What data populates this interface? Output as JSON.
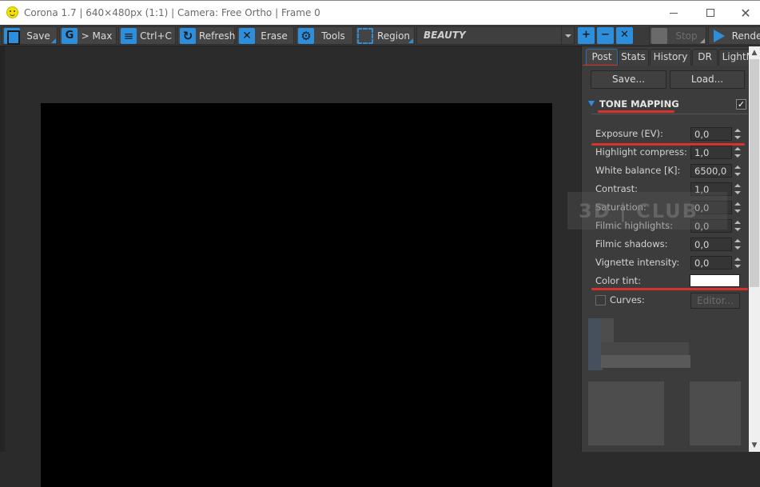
{
  "window": {
    "title": "Corona 1.7 | 640×480px (1:1) | Camera: Free Ortho | Frame 0",
    "app_icon": "smiley-icon",
    "controls": {
      "minimize": "minimize-icon",
      "maximize": "maximize-icon",
      "close": "close-icon",
      "close_glyph": "✕"
    }
  },
  "toolbar": {
    "buttons": [
      {
        "label": "Save",
        "icon": "save-icon"
      },
      {
        "label": "> Max",
        "icon": "max-icon"
      },
      {
        "label": "Ctrl+C",
        "icon": "copy-icon"
      },
      {
        "label": "Refresh",
        "icon": "refresh-icon"
      },
      {
        "label": "Erase",
        "icon": "erase-icon"
      },
      {
        "label": "Tools",
        "icon": "gear-icon"
      },
      {
        "label": "Region",
        "icon": "region-icon"
      }
    ],
    "pass_select": "BEAUTY",
    "zoom": {
      "in": "+",
      "out": "−",
      "fit": "✕"
    },
    "stop_label": "Stop",
    "render_label": "Render"
  },
  "viewport": {
    "resolution": "640×480"
  },
  "panel": {
    "tabs": [
      "Post",
      "Stats",
      "History",
      "DR",
      "LightMix"
    ],
    "active_tab": "Post",
    "save_label": "Save...",
    "load_label": "Load...",
    "section_title": "TONE MAPPING",
    "section_enabled": "✓",
    "params": [
      {
        "label": "Exposure (EV):",
        "value": "0,0"
      },
      {
        "label": "Highlight compress:",
        "value": "1,0"
      },
      {
        "label": "White balance [K]:",
        "value": "6500,0"
      },
      {
        "label": "Contrast:",
        "value": "1,0"
      },
      {
        "label": "Saturation:",
        "value": "0,0"
      },
      {
        "label": "Filmic highlights:",
        "value": "0,0"
      },
      {
        "label": "Filmic shadows:",
        "value": "0,0"
      },
      {
        "label": "Vignette intensity:",
        "value": "0,0"
      }
    ],
    "color_tint_label": "Color tint:",
    "color_tint_value": "#ffffff",
    "curves_label": "Curves:",
    "editor_label": "Editor..."
  },
  "watermark": "3D | CLUB",
  "annotation_color": "#d8322c",
  "accent_color": "#2d8fdc"
}
